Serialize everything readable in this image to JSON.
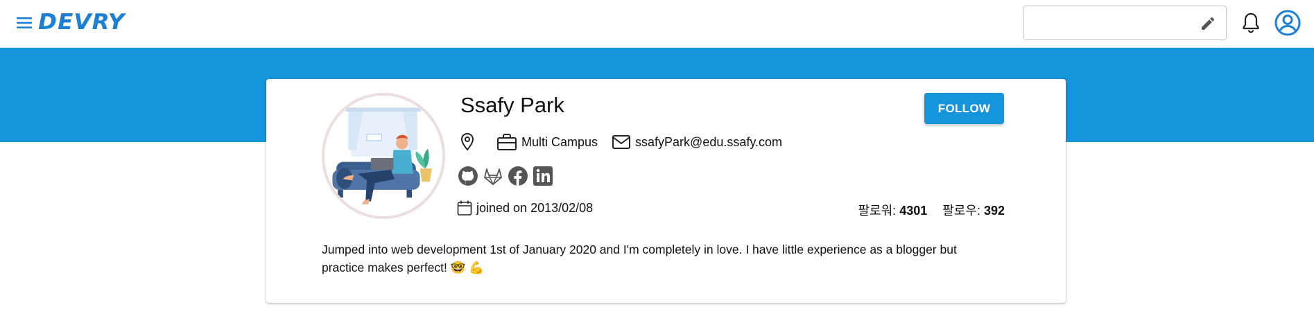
{
  "header": {
    "logo": "DEVRY",
    "search": {
      "value": "",
      "placeholder": ""
    },
    "icons": [
      "menu-icon",
      "pencil-icon",
      "bell-icon",
      "account-circle-icon"
    ]
  },
  "profile": {
    "name": "Ssafy Park",
    "follow_label": "FOLLOW",
    "location": "",
    "company": "Multi Campus",
    "email": "ssafyPark@edu.ssafy.com",
    "social_icons": [
      "github-icon",
      "gitlab-icon",
      "facebook-icon",
      "linkedin-icon"
    ],
    "joined": "joined on 2013/02/08",
    "followers_label": "팔로워:",
    "followers_count": "4301",
    "following_label": "팔로우:",
    "following_count": "392",
    "bio": "Jumped into web development 1st of January 2020 and I'm completely in love. I have little experience as a blogger but practice makes perfect! 🤓 💪"
  },
  "colors": {
    "brand": "#1c7fd4",
    "banner": "#1596dc",
    "button": "#1596dc"
  }
}
